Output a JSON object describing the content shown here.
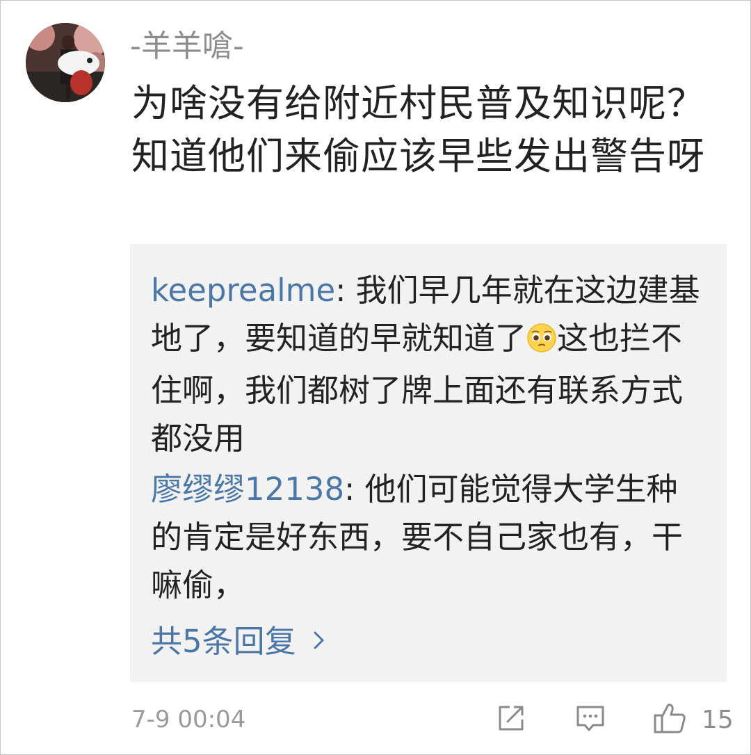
{
  "comment": {
    "username": "-羊羊嗆-",
    "text": "为啥没有给附近村民普及知识呢？知道他们来偷应该早些发出警告呀",
    "timestamp": "7-9 00:04",
    "like_count": "15",
    "avatar_icon": "user-avatar-photo"
  },
  "replies": [
    {
      "user": "keeprealme",
      "separator": ": ",
      "text_before_emoji": "我们早几年就在这边建基地了，要知道的早就知道了",
      "emoji": "pleading-face-emoji",
      "text_after_emoji": "这也拦不住啊，我们都树了牌上面还有联系方式都没用"
    },
    {
      "user": "廖缪缪12138",
      "separator": ": ",
      "text": "他们可能觉得大学生种的肯定是好东西，要不自己家也有，干嘛偷，"
    }
  ],
  "more_replies_label": "共5条回复",
  "actions": {
    "share_icon": "share-icon",
    "reply_icon": "comment-icon",
    "like_icon": "thumbs-up-icon"
  },
  "colors": {
    "link_blue": "#4a77a8",
    "text_dark": "#222222",
    "text_gray": "#8c8c8c",
    "reply_bg": "#f2f2f2"
  }
}
